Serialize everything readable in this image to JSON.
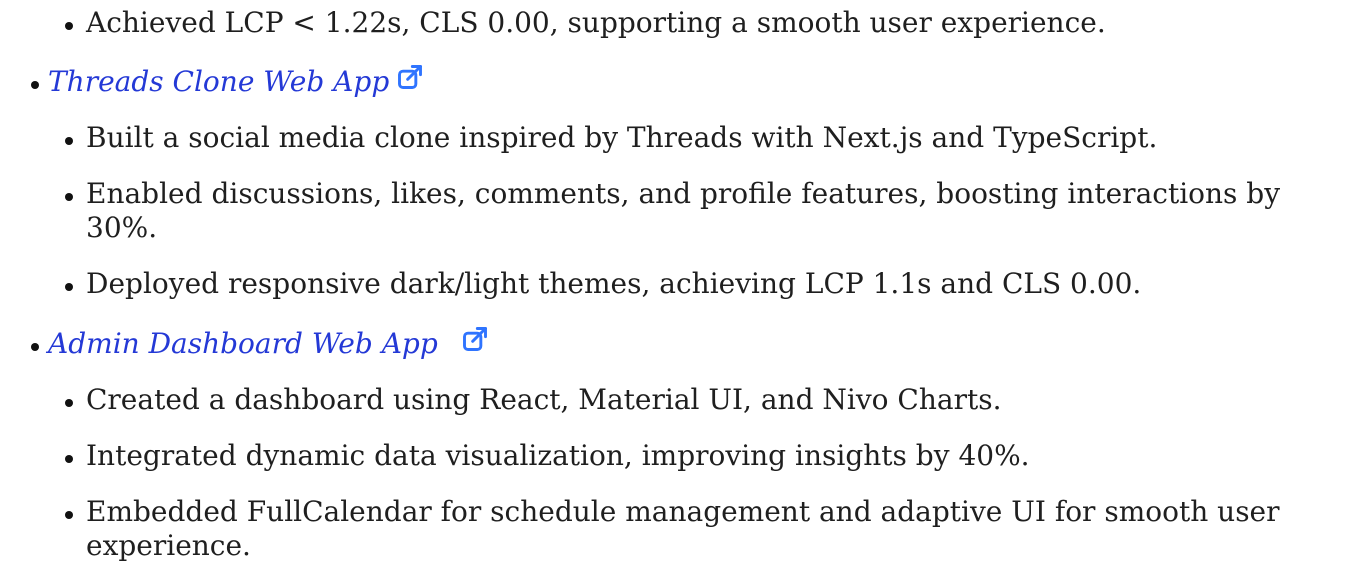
{
  "projects": [
    {
      "title": null,
      "items": [
        "Achieved LCP < 1.22s, CLS 0.00, supporting a smooth user experience."
      ]
    },
    {
      "title": "Threads Clone Web App",
      "items": [
        "Built a social media clone inspired by Threads with Next.js and TypeScript.",
        "Enabled discussions, likes, comments, and profile features, boosting interactions by 30%.",
        "Deployed responsive dark/light themes, achieving LCP 1.1s and CLS 0.00."
      ]
    },
    {
      "title": "Admin Dashboard Web App",
      "items": [
        "Created a dashboard using React, Material UI, and Nivo Charts.",
        "Integrated dynamic data visualization, improving insights by 40%.",
        "Embedded FullCalendar for schedule management and adaptive UI for smooth user experience."
      ]
    }
  ],
  "colors": {
    "link": "#2439d6",
    "icon": "#2f74ff",
    "text": "#1f1f1f"
  },
  "icons": {
    "external": "external-link-icon"
  }
}
